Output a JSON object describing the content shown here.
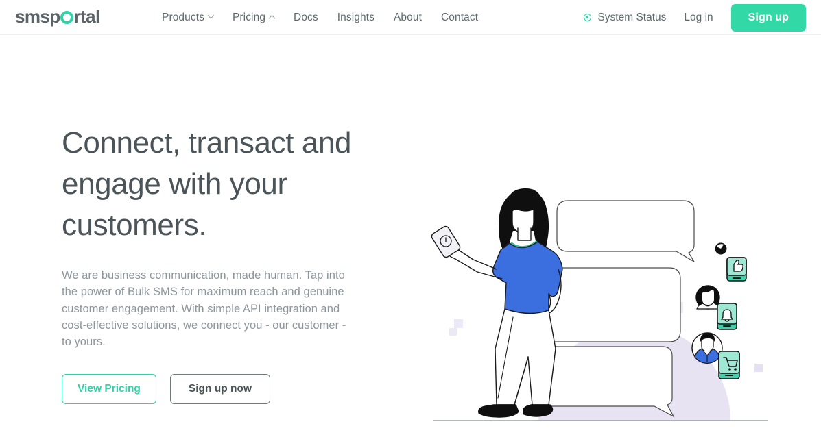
{
  "brand": {
    "logo_prefix": "smsp",
    "logo_ring": "o",
    "logo_suffix": "rtal",
    "accent_color": "#2ed3a7",
    "accent_button_color": "#32d8a5",
    "heading_color": "#4b5458",
    "body_color": "#8c969b",
    "illustration_blue": "#3b6fe0",
    "illustration_teal": "#3fd0ac",
    "illustration_lavender": "#e7e3f3"
  },
  "header": {
    "nav_items": [
      {
        "label": "Products",
        "icon": "chevron-down-icon",
        "has_chevron": true,
        "chevron_dir": "down"
      },
      {
        "label": "Pricing",
        "icon": "chevron-up-icon",
        "has_chevron": true,
        "chevron_dir": "up"
      },
      {
        "label": "Docs",
        "has_chevron": false
      },
      {
        "label": "Insights",
        "has_chevron": false
      },
      {
        "label": "About",
        "has_chevron": false
      },
      {
        "label": "Contact",
        "has_chevron": false
      }
    ],
    "system_status": {
      "label": "System Status",
      "icon": "status-indicator-icon"
    },
    "login_label": "Log in",
    "signup_label": "Sign up"
  },
  "hero": {
    "title": "Connect, transact and engage with your customers.",
    "subtitle": "We are business communication, made human. Tap into the power of Bulk SMS for maximum reach and genuine customer engagement. With simple API integration and cost-effective solutions, we connect you - our customer - to yours.",
    "primary_cta": "View Pricing",
    "secondary_cta": "Sign up now",
    "illustration": {
      "name": "woman-with-phone-and-chat-bubbles",
      "elements": [
        "speech-bubble-top",
        "speech-bubble-middle",
        "speech-bubble-bottom",
        "woman-figure",
        "smartphone-in-hand",
        "lavender-semicircle",
        "ground-line",
        "avatar-thumbsup-phone",
        "avatar-bell-phone",
        "avatar-cart-phone",
        "lavender-squares"
      ]
    }
  }
}
